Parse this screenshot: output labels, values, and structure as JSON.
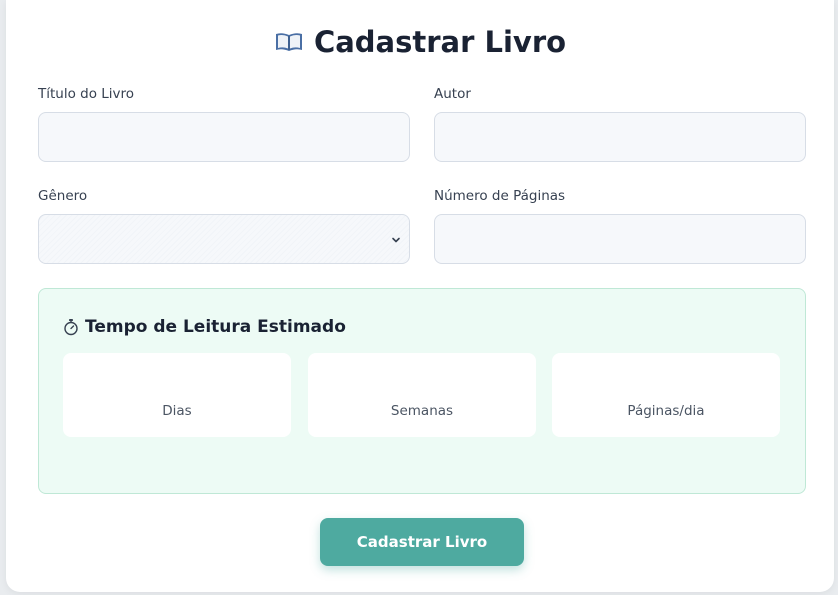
{
  "header": {
    "title": "Cadastrar Livro",
    "icon": "open-book-icon"
  },
  "form": {
    "title_field": {
      "label": "Título do Livro",
      "value": "",
      "placeholder": ""
    },
    "author_field": {
      "label": "Autor",
      "value": "",
      "placeholder": ""
    },
    "genre_field": {
      "label": "Gênero",
      "value": "",
      "icon": "chevron-down-icon"
    },
    "pages_field": {
      "label": "Número de Páginas",
      "value": "",
      "placeholder": ""
    }
  },
  "estimate": {
    "icon": "stopwatch-icon",
    "title": "Tempo de Leitura Estimado",
    "stats": [
      {
        "label": "Dias"
      },
      {
        "label": "Semanas"
      },
      {
        "label": "Páginas/dia"
      }
    ]
  },
  "actions": {
    "submit_label": "Cadastrar Livro"
  },
  "colors": {
    "accent": "#4eaaa0",
    "estimate_bg": "#edfbf5",
    "estimate_border": "#bfe8d6",
    "input_bg": "#f6f8fb",
    "input_border": "#d7dde6"
  }
}
